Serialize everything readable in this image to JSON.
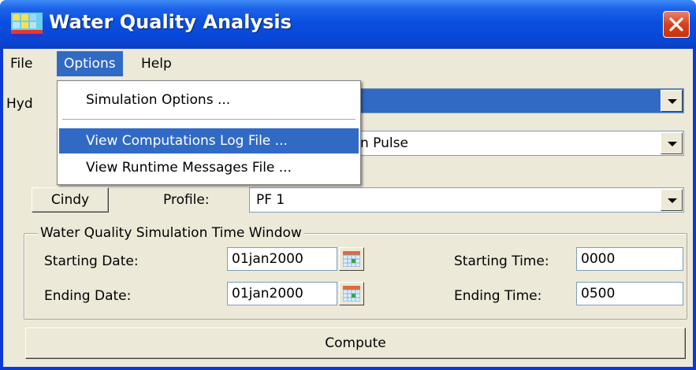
{
  "window": {
    "title": "Water Quality Analysis",
    "icon": "app-grid-icon",
    "close_icon": "close-icon"
  },
  "menubar": {
    "items": [
      {
        "label": "File"
      },
      {
        "label": "Options"
      },
      {
        "label": "Help"
      }
    ],
    "active": "Options"
  },
  "options_menu": {
    "items": [
      {
        "label": "Simulation Options ..."
      },
      {
        "label": "View Computations Log File ..."
      },
      {
        "label": "View Runtime Messages File ..."
      }
    ],
    "highlighted": "View Computations Log File ..."
  },
  "form": {
    "hydraulics_label_partial": "Hyd",
    "hydraulics_value": "",
    "plan_value_partial": "n Pulse",
    "cindy_button": "Cindy",
    "profile_label": "Profile:",
    "profile_value": "PF 1",
    "time_window": {
      "title": "Water Quality Simulation Time Window",
      "starting_date_label": "Starting Date:",
      "starting_date": "01jan2000",
      "ending_date_label": "Ending Date:",
      "ending_date": "01jan2000",
      "starting_time_label": "Starting Time:",
      "starting_time": "0000",
      "ending_time_label": "Ending Time:",
      "ending_time": "0500"
    },
    "compute_button": "Compute"
  },
  "colors": {
    "titlebar": "#0b4fe0",
    "menu_highlight": "#316ac5",
    "face": "#ece9d8",
    "close_button": "#d8411d"
  }
}
